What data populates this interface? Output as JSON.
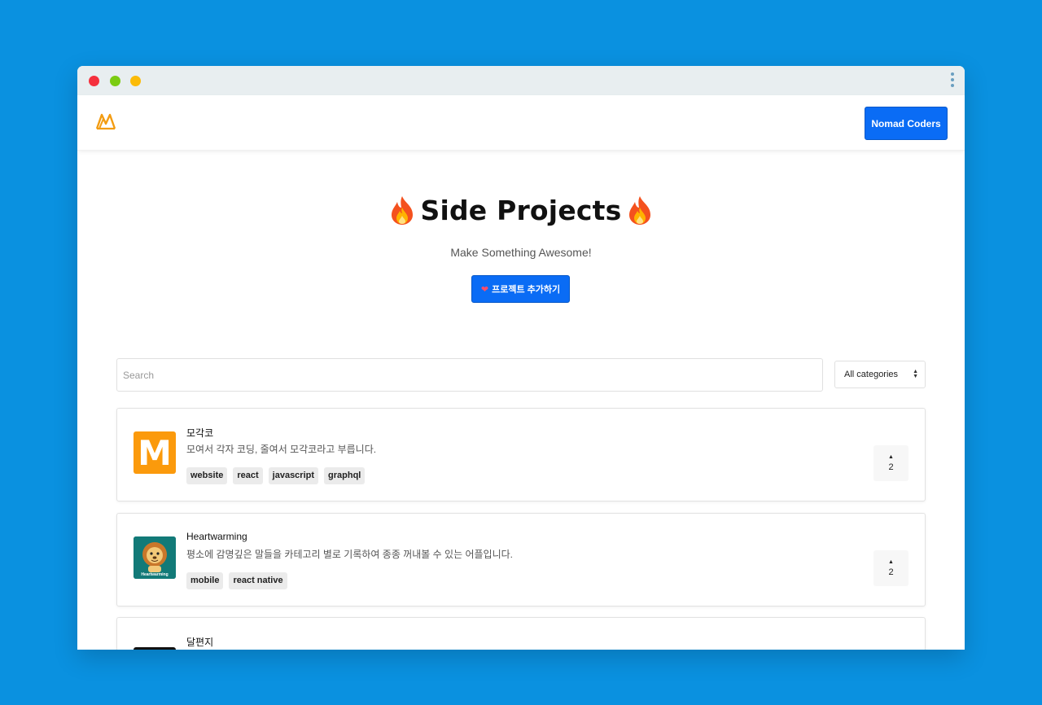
{
  "navbar": {
    "button_label": "Nomad Coders"
  },
  "hero": {
    "title": "Side Projects",
    "subtitle": "Make Something Awesome!",
    "add_button_label": "프로젝트 추가하기"
  },
  "filters": {
    "search_placeholder": "Search",
    "category_selected": "All categories"
  },
  "projects": [
    {
      "name": "모각코",
      "description": "모여서 각자 코딩, 줄여서 모각코라고 부릅니다.",
      "tags": [
        "website",
        "react",
        "javascript",
        "graphql"
      ],
      "votes": "2",
      "thumb_letter": "M"
    },
    {
      "name": "Heartwarming",
      "description": "평소에 감명깊은 말들을 카테고리 별로 기록하여 종종 꺼내볼 수 있는 어플입니다.",
      "tags": [
        "mobile",
        "react native"
      ],
      "votes": "2",
      "thumb_caption": "Heartwarming"
    },
    {
      "name": "달편지"
    }
  ],
  "colors": {
    "background": "#0a91e0",
    "primary": "#0a6cf5",
    "logo": "#f39c12",
    "moka_thumb": "#fb9a0c",
    "heartwarming_thumb": "#127a78"
  }
}
